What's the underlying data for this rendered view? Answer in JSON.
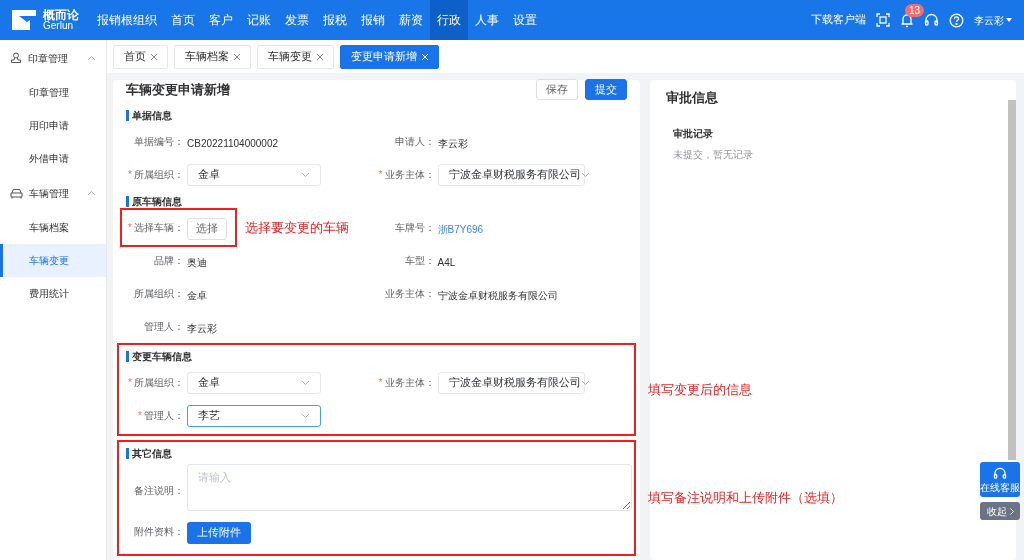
{
  "header": {
    "logo": "概而论",
    "logo_sub": "Gerlun",
    "nav": [
      {
        "label": "报销根组织",
        "selected": false
      },
      {
        "label": "首页",
        "selected": false
      },
      {
        "label": "客户",
        "selected": false
      },
      {
        "label": "记账",
        "selected": false
      },
      {
        "label": "发票",
        "selected": false
      },
      {
        "label": "报税",
        "selected": false
      },
      {
        "label": "报销",
        "selected": false
      },
      {
        "label": "薪资",
        "selected": false
      },
      {
        "label": "行政",
        "selected": true
      },
      {
        "label": "人事",
        "selected": false
      },
      {
        "label": "设置",
        "selected": false
      }
    ],
    "download": "下载客户端",
    "badge": "13",
    "user": "李云彩"
  },
  "sidebar": [
    {
      "label": "印章管理",
      "kind": "stamp",
      "expanded": true,
      "items": [
        {
          "label": "印章管理",
          "selected": false
        },
        {
          "label": "用印申请",
          "selected": false
        },
        {
          "label": "外借申请",
          "selected": false
        }
      ]
    },
    {
      "label": "车辆管理",
      "kind": "car",
      "expanded": true,
      "items": [
        {
          "label": "车辆档案",
          "selected": false
        },
        {
          "label": "车辆变更",
          "selected": true
        },
        {
          "label": "费用统计",
          "selected": false
        }
      ]
    }
  ],
  "tabs": [
    {
      "label": "首页",
      "selected": false
    },
    {
      "label": "车辆档案",
      "selected": false
    },
    {
      "label": "车辆变更",
      "selected": false
    },
    {
      "label": "变更申请新增",
      "selected": true
    }
  ],
  "form": {
    "title": "车辆变更申请新增",
    "buttons": [
      {
        "label": "保存",
        "kind": "default"
      },
      {
        "label": "提交",
        "kind": "primary"
      }
    ],
    "sections": [
      {
        "title": "单据信息",
        "fields": [
          {
            "label": "单据编号：",
            "kind": "text",
            "value": "CB20221104000002"
          },
          {
            "label": "申请人：",
            "kind": "text",
            "value": "李云彩"
          },
          {
            "label": "所属组织：",
            "kind": "select",
            "required_mark": "*",
            "value": "金卓"
          },
          {
            "label": "业务主体：",
            "kind": "select",
            "required_mark": "*",
            "value": "宁波金卓财税服务有限公司"
          }
        ]
      },
      {
        "title": "原车辆信息",
        "fields": [
          {
            "label": "选择车辆：",
            "kind": "button",
            "required_mark": "*",
            "value": "选择",
            "highlighted": true,
            "note": "选择要变更的车辆"
          },
          {
            "label": "车牌号：",
            "kind": "link",
            "value": "浙B7Y696"
          },
          {
            "label": "品牌：",
            "kind": "text",
            "value": "奥迪"
          },
          {
            "label": "车型：",
            "kind": "text",
            "value": "A4L"
          },
          {
            "label": "所属组织：",
            "kind": "text",
            "value": "金卓"
          },
          {
            "label": "业务主体：",
            "kind": "text",
            "value": "宁波金卓财税服务有限公司"
          },
          {
            "label": "管理人：",
            "kind": "text",
            "value": "李云彩"
          }
        ]
      },
      {
        "title": "变更车辆信息",
        "highlighted": true,
        "note": "填写变更后的信息",
        "fields": [
          {
            "label": "所属组织：",
            "kind": "select",
            "required_mark": "*",
            "value": "金卓",
            "focused": false
          },
          {
            "label": "业务主体：",
            "kind": "select",
            "required_mark": "*",
            "value": "宁波金卓财税服务有限公司",
            "focused": false
          },
          {
            "label": "管理人：",
            "kind": "select",
            "required_mark": "*",
            "value": "李艺",
            "focused": true
          }
        ]
      },
      {
        "title": "其它信息",
        "highlighted": true,
        "note": "填写备注说明和上传附件（选填）",
        "fields": [
          {
            "label": "备注说明：",
            "kind": "textarea",
            "placeholder": "请输入"
          },
          {
            "label": "附件资料：",
            "kind": "upload",
            "value": "上传附件"
          }
        ]
      }
    ]
  },
  "approval": {
    "title": "审批信息",
    "subtitle": "审批记录",
    "empty": "未提交，暂无记录"
  },
  "float": {
    "service": "在线客服",
    "collapse": "收起"
  }
}
